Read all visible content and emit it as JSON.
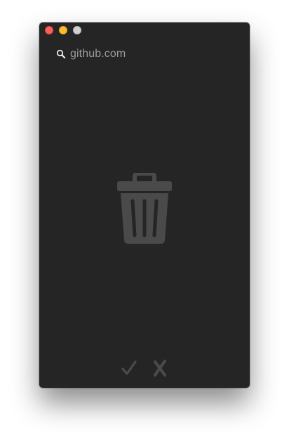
{
  "window": {
    "traffic_lights": [
      {
        "name": "close",
        "color": "#fc5f57"
      },
      {
        "name": "minimize",
        "color": "#fdbc2e"
      },
      {
        "name": "zoom",
        "color": "#d0d0d0"
      }
    ]
  },
  "search": {
    "icon": "search-icon",
    "text": "github.com"
  },
  "content": {
    "icon": "trash-icon",
    "icon_color": "#4a4a4a"
  },
  "actions": {
    "confirm_icon": "checkmark-icon",
    "cancel_icon": "x-icon",
    "icon_color": "#4a4a4a"
  },
  "colors": {
    "window_background": "#252525",
    "text": "#9a9a9a"
  }
}
